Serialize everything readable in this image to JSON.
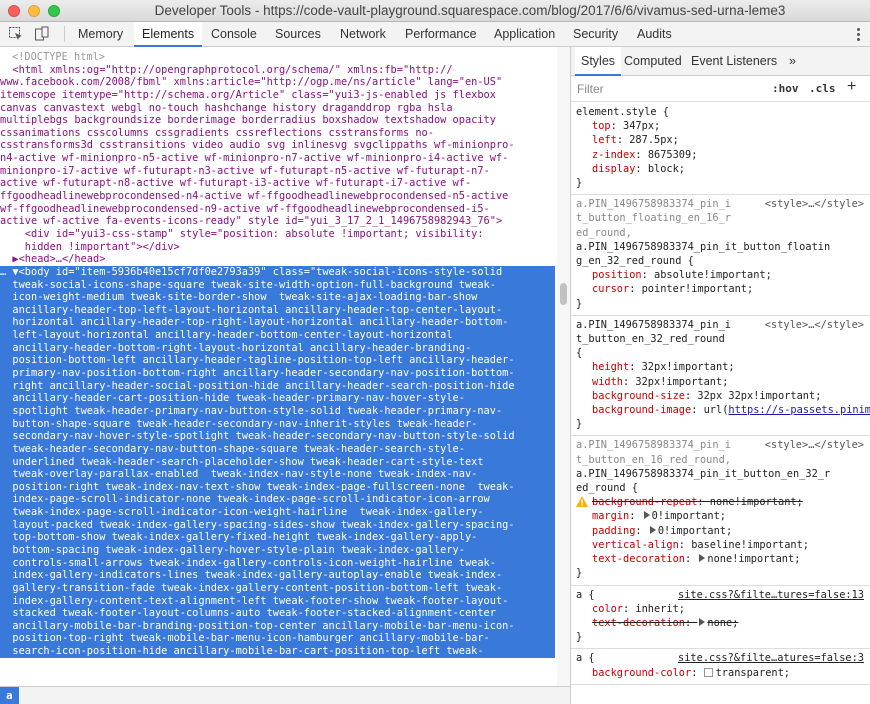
{
  "window": {
    "title": "Developer Tools - https://code-vault-playground.squarespace.com/blog/2017/6/6/vivamus-sed-urna-leme3"
  },
  "toolbar": {
    "tabs": [
      {
        "label": "Memory"
      },
      {
        "label": "Elements"
      },
      {
        "label": "Console"
      },
      {
        "label": "Sources"
      },
      {
        "label": "Network"
      },
      {
        "label": "Performance"
      },
      {
        "label": "Application"
      },
      {
        "label": "Security"
      },
      {
        "label": "Audits"
      }
    ],
    "active_tab": "Elements"
  },
  "elements": {
    "doctype": "<!DOCTYPE html>",
    "html_lines": [
      "  <html xmlns:og=\"http://opengraphprotocol.org/schema/\" xmlns:fb=\"http://",
      "www.facebook.com/2008/fbml\" xmlns:article=\"http://ogp.me/ns/article\" lang=\"en-US\"",
      "itemscope itemtype=\"http://schema.org/Article\" class=\"yui3-js-enabled js flexbox",
      "canvas canvastext webgl no-touch hashchange history draganddrop rgba hsla",
      "multiplebgs backgroundsize borderimage borderradius boxshadow textshadow opacity",
      "cssanimations csscolumns cssgradients cssreflections csstransforms no-",
      "csstransforms3d csstransitions video audio svg inlinesvg svgclippaths wf-minionpro-",
      "n4-active wf-minionpro-n5-active wf-minionpro-n7-active wf-minionpro-i4-active wf-",
      "minionpro-i7-active wf-futurapt-n3-active wf-futurapt-n5-active wf-futurapt-n7-",
      "active wf-futurapt-n8-active wf-futurapt-i3-active wf-futurapt-i7-active wf-",
      "ffgoodheadlinewebprocondensed-n4-active wf-ffgoodheadlinewebprocondensed-n5-active",
      "wf-ffgoodheadlinewebprocondensed-n9-active wf-ffgoodheadlinewebprocondensed-i5-",
      "active wf-active fa-events-icons-ready\" style id=\"yui_3_17_2_1_1496758982943_76\">",
      "    <div id=\"yui3-css-stamp\" style=\"position: absolute !important; visibility:",
      "    hidden !important\"></div>",
      "  ▶<head>…</head>"
    ],
    "body_lines": [
      "… ▼<body id=\"item-5936b40e15cf7df0e2793a39\" class=\"tweak-social-icons-style-solid",
      "  tweak-social-icons-shape-square tweak-site-width-option-full-background tweak-",
      "  icon-weight-medium tweak-site-border-show  tweak-site-ajax-loading-bar-show",
      "  ancillary-header-top-left-layout-horizontal ancillary-header-top-center-layout-",
      "  horizontal ancillary-header-top-right-layout-horizontal ancillary-header-bottom-",
      "  left-layout-horizontal ancillary-header-bottom-center-layout-horizontal",
      "  ancillary-header-bottom-right-layout-horizontal ancillary-header-branding-",
      "  position-bottom-left ancillary-header-tagline-position-top-left ancillary-header-",
      "  primary-nav-position-bottom-right ancillary-header-secondary-nav-position-bottom-",
      "  right ancillary-header-social-position-hide ancillary-header-search-position-hide",
      "  ancillary-header-cart-position-hide tweak-header-primary-nav-hover-style-",
      "  spotlight tweak-header-primary-nav-button-style-solid tweak-header-primary-nav-",
      "  button-shape-square tweak-header-secondary-nav-inherit-styles tweak-header-",
      "  secondary-nav-hover-style-spotlight tweak-header-secondary-nav-button-style-solid",
      "  tweak-header-secondary-nav-button-shape-square tweak-header-search-style-",
      "  underlined tweak-header-search-placeholder-show tweak-header-cart-style-text",
      "  tweak-overlay-parallax-enabled  tweak-index-nav-style-none tweak-index-nav-",
      "  position-right tweak-index-nav-text-show tweak-index-page-fullscreen-none  tweak-",
      "  index-page-scroll-indicator-none tweak-index-page-scroll-indicator-icon-arrow",
      "  tweak-index-page-scroll-indicator-icon-weight-hairline  tweak-index-gallery-",
      "  layout-packed tweak-index-gallery-spacing-sides-show tweak-index-gallery-spacing-",
      "  top-bottom-show tweak-index-gallery-fixed-height tweak-index-gallery-apply-",
      "  bottom-spacing tweak-index-gallery-hover-style-plain tweak-index-gallery-",
      "  controls-small-arrows tweak-index-gallery-controls-icon-weight-hairline tweak-",
      "  index-gallery-indicators-lines tweak-index-gallery-autoplay-enable tweak-index-",
      "  gallery-transition-fade tweak-index-gallery-content-position-bottom-left tweak-",
      "  index-gallery-content-text-alignment-left tweak-footer-show tweak-footer-layout-",
      "  stacked tweak-footer-layout-columns-auto tweak-footer-stacked-alignment-center",
      "  ancillary-mobile-bar-branding-position-top-center ancillary-mobile-bar-menu-icon-",
      "  position-top-right tweak-mobile-bar-menu-icon-hamburger ancillary-mobile-bar-",
      "  search-icon-position-hide ancillary-mobile-bar-cart-position-top-left tweak-"
    ],
    "breadcrumb": "a"
  },
  "sidebar": {
    "tabs": [
      {
        "label": "Styles"
      },
      {
        "label": "Computed"
      },
      {
        "label": "Event Listeners"
      },
      {
        "label": "»"
      }
    ],
    "filter_placeholder": "Filter",
    "hov": ":hov",
    "cls": ".cls",
    "plus": "+",
    "rules": [
      {
        "selector": "element.style {",
        "source": "",
        "props": [
          {
            "name": "top",
            "value": "347px;"
          },
          {
            "name": "left",
            "value": "287.5px;"
          },
          {
            "name": "z-index",
            "value": "8675309;"
          },
          {
            "name": "display",
            "value": "block;"
          }
        ],
        "close": "}"
      },
      {
        "selector_grey": "a.PIN_1496758983374_pin_i",
        "source": "<style>…</style>",
        "selector_lines": [
          "t_button_floating_en_16_r",
          "ed_round,"
        ],
        "selector_main": [
          "a.PIN_1496758983374_pin_it_button_floatin",
          "g_en_32_red_round {"
        ],
        "props": [
          {
            "name": "position",
            "value": "absolute!important;"
          },
          {
            "name": "cursor",
            "value": "pointer!important;"
          }
        ],
        "close": "}"
      },
      {
        "selector_main": [
          "a.PIN_1496758983374_pin_i",
          "t_button_en_32_red_round",
          "{"
        ],
        "source": "<style>…</style>",
        "props": [
          {
            "name": "height",
            "value": "32px!important;"
          },
          {
            "name": "width",
            "value": "32px!important;"
          },
          {
            "name": "background-size",
            "value": "32px 32px!important;"
          },
          {
            "name": "background-image",
            "value": "url(",
            "link": "https://s-passets.pinimg.com/images/pidgets/pin"
          }
        ],
        "close": "}"
      },
      {
        "selector_grey": "a.PIN_1496758983374_pin_i",
        "source": "<style>…</style>",
        "selector_lines_grey": [
          "t_button_en_16_red_round,"
        ],
        "selector_main": [
          "a.PIN_1496758983374_pin_it_button_en_32_r",
          "ed_round {"
        ],
        "props": [
          {
            "name": "background-repeat",
            "value": "none!important;",
            "struck": true,
            "warn": true
          },
          {
            "name": "margin",
            "value": "0!important;",
            "tri": true
          },
          {
            "name": "padding",
            "value": "0!important;",
            "tri": true
          },
          {
            "name": "vertical-align",
            "value": "baseline!important;"
          },
          {
            "name": "text-decoration",
            "value": "none!important;",
            "tri": true
          }
        ],
        "close": "}"
      },
      {
        "selector_main": [
          "a {"
        ],
        "source": "site.css?&filte…tures=false:13",
        "props": [
          {
            "name": "color",
            "value": "inherit;"
          },
          {
            "name": "text-decoration",
            "value": "none;",
            "struck": true,
            "tri": true
          }
        ],
        "close": "}"
      },
      {
        "selector_main": [
          "a {"
        ],
        "source": "site.css?&filte…atures=false:3",
        "props": [
          {
            "name": "background-color",
            "value": "transparent;",
            "swatch": true
          }
        ],
        "close": ""
      }
    ]
  }
}
